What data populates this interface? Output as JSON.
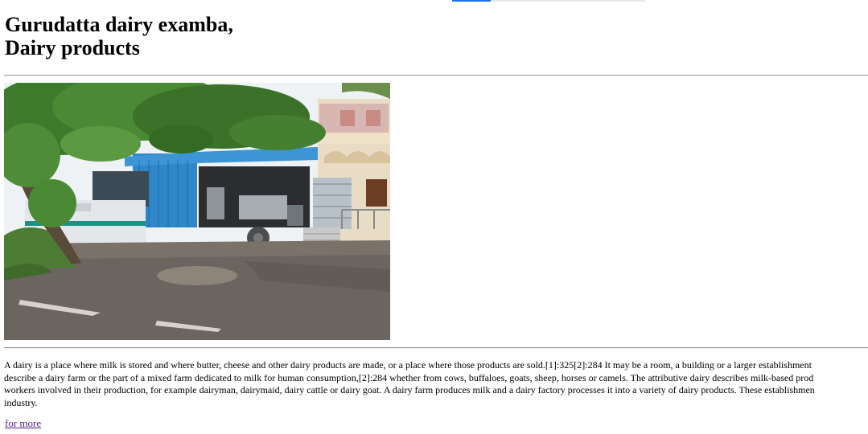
{
  "heading": {
    "line1": "Gurudatta dairy examba,",
    "line2": "Dairy products"
  },
  "photo": {
    "subject": "dairy-shop-photo"
  },
  "description": {
    "lines": [
      "A dairy is a place where milk is stored and where butter, cheese and other dairy products are made, or a place where those products are sold.[1]:325[2]:284 It may be a room, a building or a larger establishment",
      "describe a dairy farm or the part of a mixed farm dedicated to milk for human consumption,[2]:284 whether from cows, buffaloes, goats, sheep, horses or camels. The attributive dairy describes milk-based prod",
      "workers involved in their production, for example dairyman, dairymaid, dairy cattle or dairy goat. A dairy farm produces milk and a dairy factory processes it into a variety of dairy products. These establishmen",
      "industry."
    ]
  },
  "link": {
    "label": "for more"
  },
  "colors": {
    "link": "#551a8b",
    "rule": "#9a9a9a",
    "accent": "#1a73e8"
  }
}
